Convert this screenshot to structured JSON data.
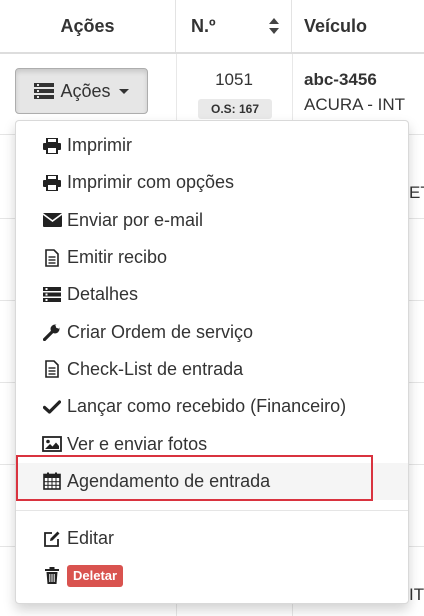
{
  "table": {
    "headers": {
      "acoes": "Ações",
      "numero": "N.º",
      "veiculo": "Veículo"
    },
    "row1": {
      "button_label": "Ações",
      "number": "1051",
      "os_badge": "O.S: 167",
      "placa": "abc-3456",
      "modelo": "ACURA - INT"
    },
    "peek_texts": {
      "row2_suffix": "ET",
      "row_bottom_suffix": "IT"
    }
  },
  "dropdown": {
    "items": [
      {
        "label": "Imprimir",
        "icon": "print-icon"
      },
      {
        "label": "Imprimir com opções",
        "icon": "print-icon"
      },
      {
        "label": "Enviar por e-mail",
        "icon": "envelope-icon"
      },
      {
        "label": "Emitir recibo",
        "icon": "file-text-icon"
      },
      {
        "label": "Detalhes",
        "icon": "list-icon"
      },
      {
        "label": "Criar Ordem de serviço",
        "icon": "wrench-icon"
      },
      {
        "label": "Check-List de entrada",
        "icon": "file-text-icon"
      },
      {
        "label": "Lançar como recebido (Financeiro)",
        "icon": "check-icon"
      },
      {
        "label": "Ver e enviar fotos",
        "icon": "picture-icon"
      },
      {
        "label": "Agendamento de entrada",
        "icon": "calendar-icon"
      }
    ],
    "editar": {
      "label": "Editar",
      "icon": "edit-icon"
    },
    "deletar": {
      "label": "Deletar",
      "icon": "trash-icon"
    }
  },
  "colors": {
    "highlight_border": "#d9333f",
    "delete_badge": "#d9534f"
  }
}
